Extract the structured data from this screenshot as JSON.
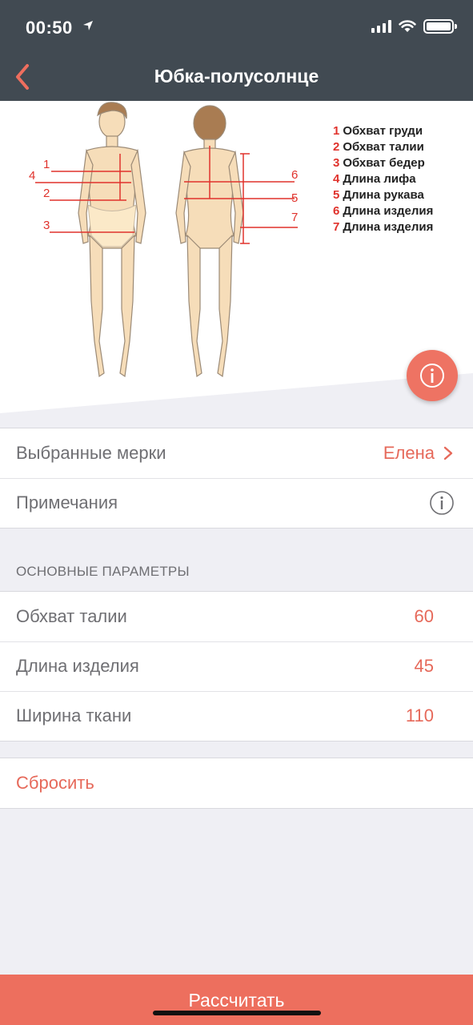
{
  "status": {
    "time": "00:50"
  },
  "nav": {
    "title": "Юбка-полусолнце"
  },
  "figure": {
    "markers": [
      "1",
      "2",
      "3",
      "4",
      "5",
      "6",
      "7"
    ],
    "legend": [
      {
        "num": "1",
        "label": "Обхват груди"
      },
      {
        "num": "2",
        "label": "Обхват талии"
      },
      {
        "num": "3",
        "label": "Обхват бедер"
      },
      {
        "num": "4",
        "label": "Длина лифа"
      },
      {
        "num": "5",
        "label": "Длина рукава"
      },
      {
        "num": "6",
        "label": "Длина изделия"
      },
      {
        "num": "7",
        "label": "Длина изделия"
      }
    ]
  },
  "measurements": {
    "selected_label": "Выбранные мерки",
    "selected_value": "Елена",
    "notes_label": "Примечания"
  },
  "params": {
    "header": "ОСНОВНЫЕ ПАРАМЕТРЫ",
    "items": [
      {
        "label": "Обхват талии",
        "value": "60"
      },
      {
        "label": "Длина изделия",
        "value": "45"
      },
      {
        "label": "Ширина ткани",
        "value": "110"
      }
    ]
  },
  "reset": {
    "label": "Сбросить"
  },
  "calculate": {
    "label": "Рассчитать"
  },
  "colors": {
    "accent": "#ed6f5e",
    "navbar": "#414a52",
    "marker": "#e0322c"
  }
}
